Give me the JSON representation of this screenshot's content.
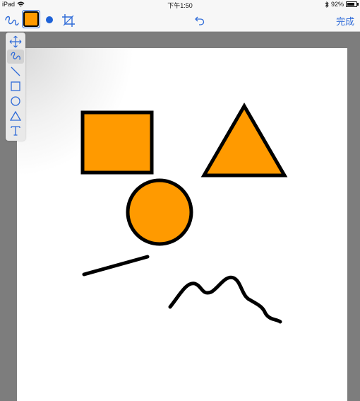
{
  "status_bar": {
    "device": "iPad",
    "time": "下午1:50",
    "battery": "92%"
  },
  "toolbar": {
    "freehand_icon": "freehand-curve-icon",
    "color": "#ff9a00",
    "stroke_color": "#1e62d8",
    "crop_icon": "crop-icon",
    "undo_icon": "undo-icon",
    "done_label": "完成"
  },
  "tools": [
    {
      "name": "move",
      "icon": "move-arrows-icon"
    },
    {
      "name": "freehand",
      "icon": "freehand-curve-icon",
      "selected": true
    },
    {
      "name": "line",
      "icon": "line-icon"
    },
    {
      "name": "rectangle",
      "icon": "rectangle-icon"
    },
    {
      "name": "ellipse",
      "icon": "circle-icon"
    },
    {
      "name": "triangle",
      "icon": "triangle-icon"
    },
    {
      "name": "text",
      "icon": "text-t-icon"
    }
  ],
  "drawing": {
    "fill_color": "#ff9a00",
    "stroke_color": "#000000",
    "shapes": [
      "rectangle",
      "triangle",
      "circle",
      "line",
      "freehand-stroke"
    ]
  }
}
